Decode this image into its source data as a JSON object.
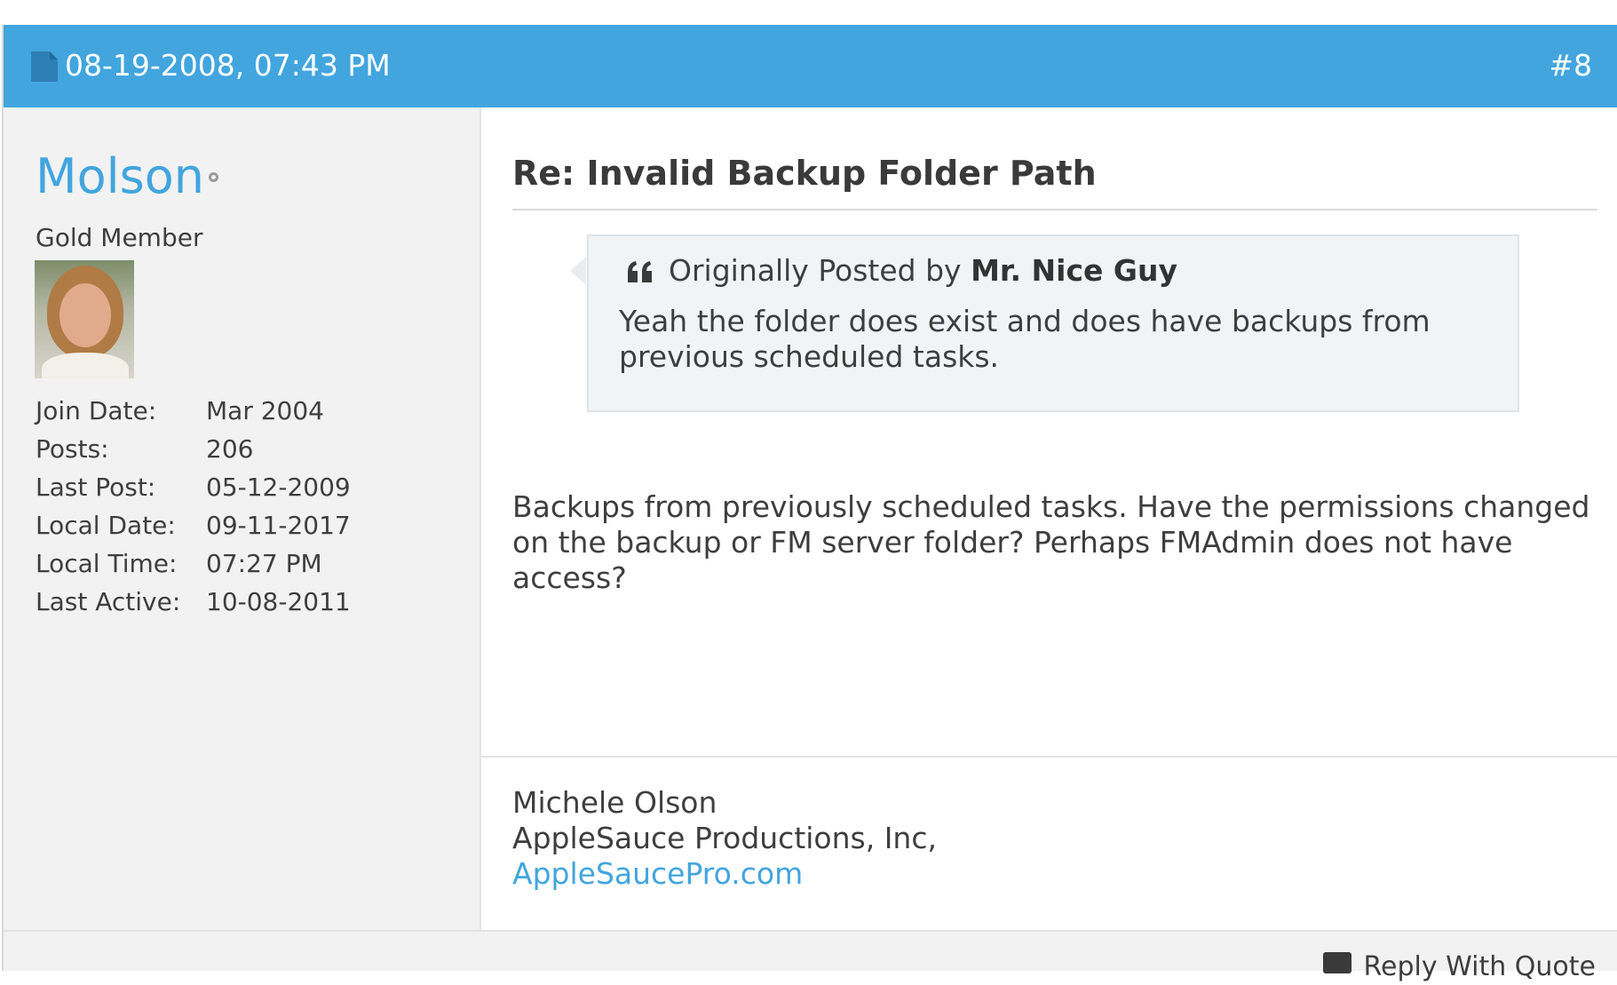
{
  "post": {
    "date": "08-19-2008, 07:43 PM",
    "number": "#8",
    "header_color": "#42a5de"
  },
  "user": {
    "name": "Molson",
    "title": "Gold Member",
    "stats": [
      {
        "label": "Join Date:",
        "value": "Mar 2004"
      },
      {
        "label": "Posts:",
        "value": "206"
      },
      {
        "label": "Last Post:",
        "value": "05-12-2009"
      },
      {
        "label": "Local Date:",
        "value": "09-11-2017"
      },
      {
        "label": "Local Time:",
        "value": "07:27 PM"
      },
      {
        "label": "Last Active:",
        "value": "10-08-2011"
      }
    ]
  },
  "body": {
    "title": "Re: Invalid Backup Folder Path",
    "quote": {
      "prefix": "Originally Posted by",
      "author": "Mr. Nice Guy",
      "text": "Yeah the folder does exist and does have backups from previous scheduled tasks."
    },
    "message": "Backups from previously scheduled tasks. Have the permissions changed on the backup or FM server folder? Perhaps FMAdmin does not have access?",
    "signature": {
      "line1": "Michele Olson",
      "line2": "AppleSauce Productions, Inc,",
      "link": "AppleSaucePro.com"
    }
  },
  "footer": {
    "reply_label": "Reply With Quote"
  }
}
